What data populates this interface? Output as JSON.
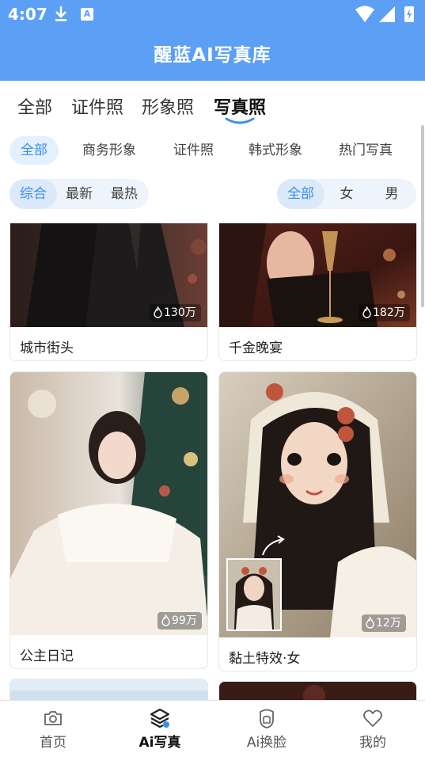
{
  "status_bar": {
    "time": "4:07"
  },
  "app": {
    "title": "醒蓝AI写真库"
  },
  "top_tabs": [
    {
      "label": "全部",
      "active": false
    },
    {
      "label": "证件照",
      "active": false
    },
    {
      "label": "形象照",
      "active": false
    },
    {
      "label": "写真照",
      "active": true
    }
  ],
  "categories": [
    {
      "label": "全部",
      "active": true
    },
    {
      "label": "商务形象",
      "active": false
    },
    {
      "label": "证件照",
      "active": false
    },
    {
      "label": "韩式形象",
      "active": false
    },
    {
      "label": "热门写真",
      "active": false
    }
  ],
  "sort_options": [
    {
      "label": "综合",
      "active": true
    },
    {
      "label": "最新",
      "active": false
    },
    {
      "label": "最热",
      "active": false
    }
  ],
  "gender_options": [
    {
      "label": "全部",
      "active": true
    },
    {
      "label": "女",
      "active": false
    },
    {
      "label": "男",
      "active": false
    }
  ],
  "cards": [
    {
      "title": "城市街头",
      "count": "130万"
    },
    {
      "title": "千金晚宴",
      "count": "182万"
    },
    {
      "title": "公主日记",
      "count": "99万"
    },
    {
      "title": "黏土特效·女",
      "count": "12万"
    }
  ],
  "bottom_nav": [
    {
      "label": "首页",
      "icon": "camera-icon",
      "active": false
    },
    {
      "label": "Ai写真",
      "icon": "layers-icon",
      "active": true
    },
    {
      "label": "Ai换脸",
      "icon": "face-shield-icon",
      "active": false
    },
    {
      "label": "我的",
      "icon": "heart-icon",
      "active": false
    }
  ],
  "colors": {
    "primary": "#5ca0f5",
    "accent": "#3b8ef0",
    "chip_bg": "#e3f0fd"
  }
}
